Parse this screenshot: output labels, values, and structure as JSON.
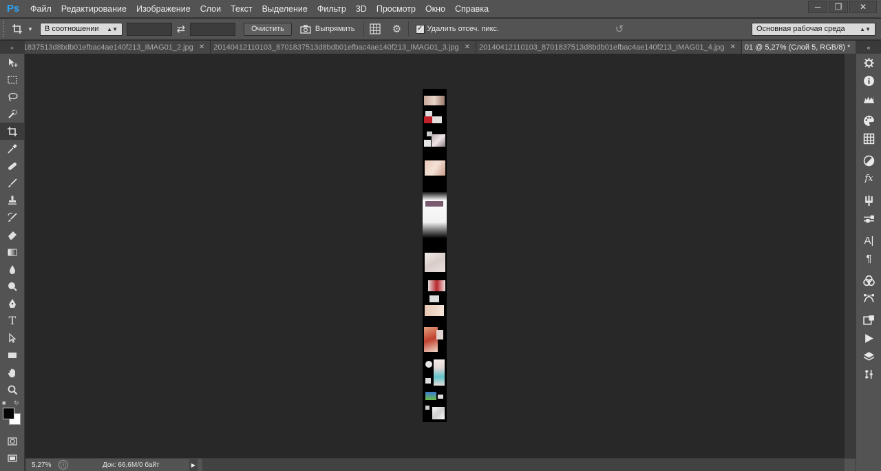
{
  "app": {
    "logo": "Ps",
    "window_controls": [
      "minimize-icon",
      "restore-icon",
      "close-icon"
    ]
  },
  "menu": {
    "items": [
      "Файл",
      "Редактирование",
      "Изображение",
      "Слои",
      "Текст",
      "Выделение",
      "Фильтр",
      "3D",
      "Просмотр",
      "Окно",
      "Справка"
    ]
  },
  "options": {
    "ratio_select": "В соотношении",
    "clear_label": "Очистить",
    "straighten_label": "Выпрямить",
    "delete_cropped_label": "Удалить отсеч. пикс.",
    "delete_cropped_checked": true,
    "workspace_select": "Основная рабочая среда"
  },
  "tabs": [
    {
      "label": "1837513d8bdb01efbac4ae140f213_IMAG01_2.jpg",
      "active": false
    },
    {
      "label": "20140412110103_8701837513d8bdb01efbac4ae140f213_IMAG01_3.jpg",
      "active": false
    },
    {
      "label": "20140412110103_8701837513d8bdb01efbac4ae140f213_IMAG01_4.jpg",
      "active": false
    },
    {
      "label": "01 @ 5,27% (Слой 5, RGB/8) *",
      "active": true
    }
  ],
  "tools": [
    "move-icon",
    "marquee-icon",
    "lasso-icon",
    "quick-select-icon",
    "crop-icon",
    "eyedropper-icon",
    "healing-icon",
    "brush-icon",
    "stamp-icon",
    "history-brush-icon",
    "eraser-icon",
    "gradient-icon",
    "blur-icon",
    "dodge-icon",
    "pen-icon",
    "type-icon",
    "path-select-icon",
    "rectangle-icon",
    "hand-icon",
    "zoom-icon"
  ],
  "status": {
    "zoom": "5,27%",
    "doc_info": "Док: 66,6M/0 байт"
  },
  "colors": {
    "foreground": "#050505",
    "background": "#ffffff",
    "accent": "#2fa3f5"
  },
  "right_panel": [
    "history-icon",
    "info-icon",
    "swatches-icon",
    "color-icon",
    "grid-icon",
    "adjustments-icon",
    "styles-icon",
    "brushes-icon",
    "brush-presets-icon",
    "character-icon",
    "paragraph-icon",
    "channels-icon",
    "paths-icon",
    "tool-presets-icon",
    "actions-icon",
    "layers-icon",
    "layer-comps-icon"
  ]
}
